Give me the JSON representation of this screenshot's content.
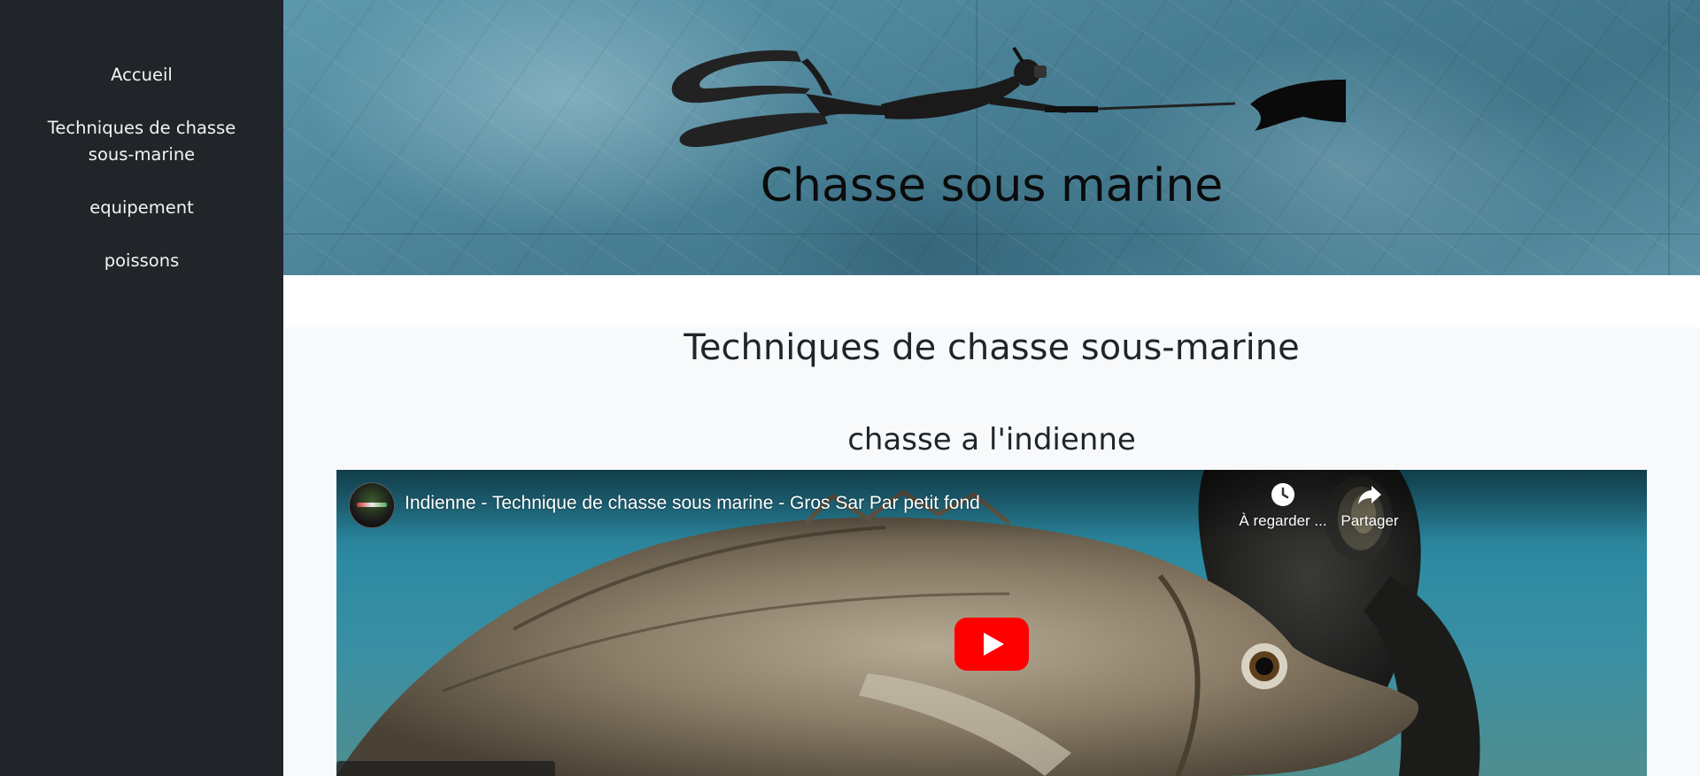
{
  "sidebar": {
    "items": [
      {
        "label": "Accueil"
      },
      {
        "label": "Techniques de chasse sous-marine"
      },
      {
        "label": "equipement"
      },
      {
        "label": "poissons"
      }
    ]
  },
  "banner": {
    "title": "Chasse sous marine"
  },
  "main": {
    "section_title": "Techniques de chasse sous-marine",
    "subsection_title": "chasse a l'indienne"
  },
  "video": {
    "title": "Indienne - Technique de chasse sous marine - Gros Sar Par petit fond",
    "watch_later_label": "À regarder ...",
    "share_label": "Partager",
    "play_button_color": "#ff0000"
  }
}
